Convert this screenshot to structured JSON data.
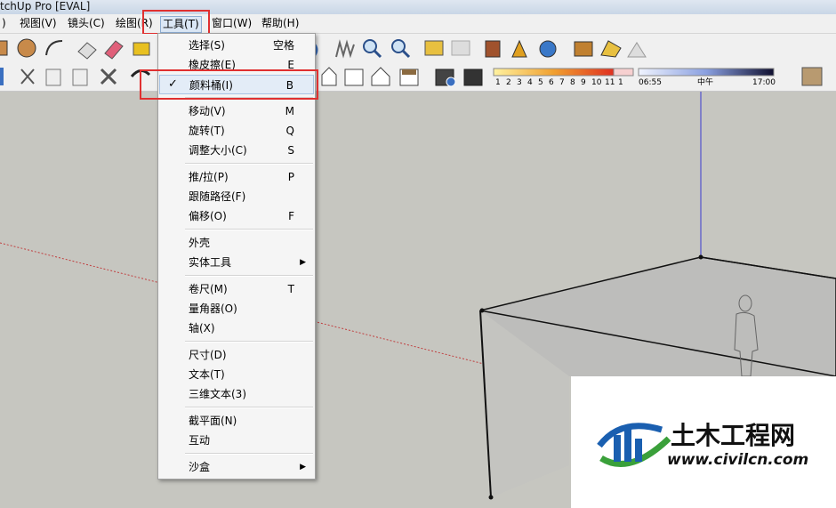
{
  "window_title": "tchUp Pro [EVAL]",
  "menubar": [
    {
      "label": ")"
    },
    {
      "label": "视图(V)"
    },
    {
      "label": "镜头(C)"
    },
    {
      "label": "绘图(R)"
    },
    {
      "label": "工具(T)"
    },
    {
      "label": "窗口(W)"
    },
    {
      "label": "帮助(H)"
    }
  ],
  "tools_menu": {
    "items": [
      {
        "label": "选择(S)",
        "key": "空格"
      },
      {
        "label": "橡皮擦(E)",
        "key": "E"
      },
      {
        "label": "颜料桶(I)",
        "key": "B",
        "checked": "✓"
      },
      {
        "label": "移动(V)",
        "key": "M"
      },
      {
        "label": "旋转(T)",
        "key": "Q"
      },
      {
        "label": "调整大小(C)",
        "key": "S"
      },
      {
        "label": "推/拉(P)",
        "key": "P"
      },
      {
        "label": "跟随路径(F)",
        "key": ""
      },
      {
        "label": "偏移(O)",
        "key": "F"
      },
      {
        "label": "外壳",
        "key": ""
      },
      {
        "label": "实体工具",
        "key": "",
        "submenu": "▶"
      },
      {
        "label": "卷尺(M)",
        "key": "T"
      },
      {
        "label": "量角器(O)",
        "key": ""
      },
      {
        "label": "轴(X)",
        "key": ""
      },
      {
        "label": "尺寸(D)",
        "key": ""
      },
      {
        "label": "文本(T)",
        "key": ""
      },
      {
        "label": "三维文本(3)",
        "key": ""
      },
      {
        "label": "截平面(N)",
        "key": ""
      },
      {
        "label": "互动",
        "key": ""
      },
      {
        "label": "沙盒",
        "key": "",
        "submenu": "▶"
      }
    ]
  },
  "shadow_bar": {
    "months": [
      "1",
      "2",
      "3",
      "4",
      "5",
      "6",
      "7",
      "8",
      "9",
      "10",
      "11",
      "1"
    ],
    "time_start": "06:55",
    "time_mid": "中午",
    "time_end": "17:00"
  },
  "watermark": {
    "brand": "土木工程网",
    "url": "www.civilcn.com"
  },
  "colors": {
    "highlight_box": "#e03030",
    "axis_blue": "#3a3ad0",
    "axis_red": "#c04040",
    "logo_blue": "#1a5fb0",
    "logo_green": "#3aa03a"
  }
}
